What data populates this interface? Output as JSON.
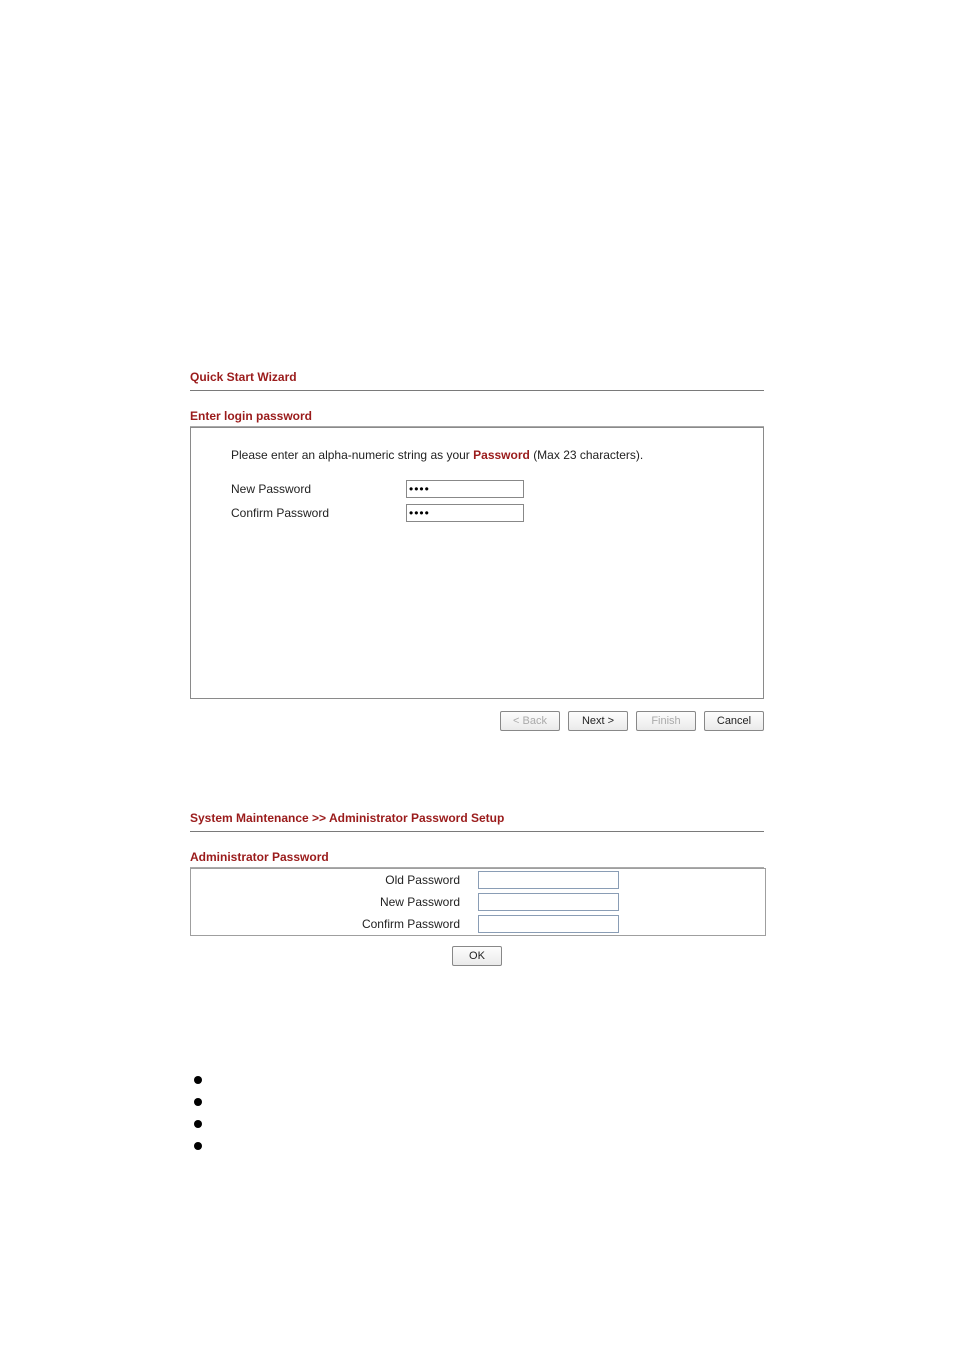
{
  "wizard": {
    "title": "Quick Start Wizard",
    "subtitle": "Enter login password",
    "instruction_pre": "Please enter an alpha-numeric string as your ",
    "instruction_bold": "Password",
    "instruction_post": " (Max 23 characters).",
    "new_password_label": "New Password",
    "confirm_password_label": "Confirm Password",
    "new_password_value": "••••",
    "confirm_password_value": "••••",
    "buttons": {
      "back": "< Back",
      "next": "Next >",
      "finish": "Finish",
      "cancel": "Cancel"
    }
  },
  "admin": {
    "breadcrumb": "System Maintenance >> Administrator Password Setup",
    "section_title": "Administrator Password",
    "old_password_label": "Old Password",
    "new_password_label": "New Password",
    "confirm_password_label": "Confirm Password",
    "ok_label": "OK"
  }
}
